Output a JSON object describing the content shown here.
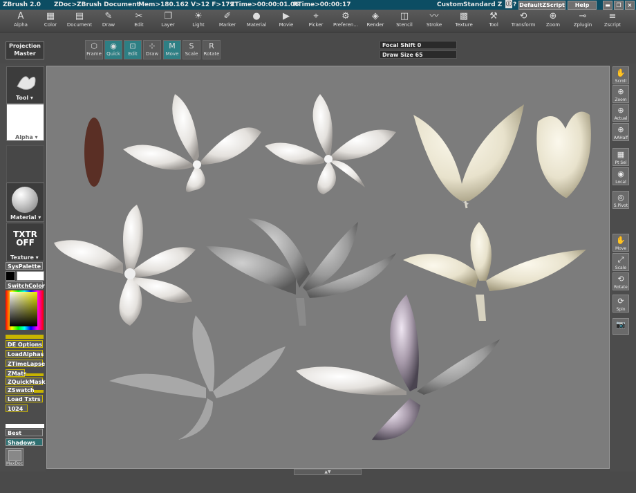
{
  "titlebar": {
    "app": "ZBrush 2.0",
    "doc": "ZDoc>ZBrush Document",
    "mem": "Mem>180.162 V>12 F>179",
    "ztime": "ZTime>00:00:01.06",
    "rtime": "RTime>00:00:17",
    "custom": "Custom",
    "standard": "Standard Z",
    "script": "DefaultZScript",
    "help": "Help"
  },
  "menu": [
    {
      "label": "Alpha",
      "icon": "A"
    },
    {
      "label": "Color",
      "icon": "▦"
    },
    {
      "label": "Document",
      "icon": "▤"
    },
    {
      "label": "Draw",
      "icon": "✎"
    },
    {
      "label": "Edit",
      "icon": "✂"
    },
    {
      "label": "Layer",
      "icon": "❐"
    },
    {
      "label": "Light",
      "icon": "☀"
    },
    {
      "label": "Marker",
      "icon": "✐"
    },
    {
      "label": "Material",
      "icon": "●"
    },
    {
      "label": "Movie",
      "icon": "▶"
    },
    {
      "label": "Picker",
      "icon": "⌖"
    },
    {
      "label": "Preferen...",
      "icon": "⚙"
    },
    {
      "label": "Render",
      "icon": "◈"
    },
    {
      "label": "Stencil",
      "icon": "◫"
    },
    {
      "label": "Stroke",
      "icon": "〰"
    },
    {
      "label": "Texture",
      "icon": "▩"
    },
    {
      "label": "Tool",
      "icon": "⚒"
    },
    {
      "label": "Transform",
      "icon": "⟲"
    },
    {
      "label": "Zoom",
      "icon": "⊕"
    },
    {
      "label": "Zplugin",
      "icon": "⊸"
    },
    {
      "label": "Zscript",
      "icon": "≡"
    }
  ],
  "toolbar": {
    "projection_master": "Projection Master",
    "buttons": [
      "Frame",
      "Quick",
      "Edit",
      "Draw",
      "Move",
      "Scale",
      "Rotate"
    ],
    "focal_shift": "Focal Shift 0",
    "draw_size": "Draw Size 65"
  },
  "left": {
    "tool": "Tool",
    "alpha": "Alpha",
    "material": "Material",
    "txtr": "TXTR",
    "off": "OFF",
    "texture": "Texture",
    "syspalette": "SysPalette",
    "switchcolor": "SwitchColor",
    "buttons": [
      "DE Options",
      "LoadAlphas",
      "ZTimeLapse",
      "ZMats",
      "ZQuickMask",
      "ZSwatch",
      "Load Txtrs",
      "1024"
    ],
    "best": "Best",
    "shadows": "Shadows",
    "maxdoc": "MaxDoc"
  },
  "right": [
    {
      "label": "Scroll",
      "icon": "✋"
    },
    {
      "label": "Zoom",
      "icon": "⊕"
    },
    {
      "label": "Actual",
      "icon": "⊕"
    },
    {
      "label": "AAHalf",
      "icon": "⊕"
    },
    {
      "label": "Pt Sel",
      "icon": "▦"
    },
    {
      "label": "Local",
      "icon": "◉"
    },
    {
      "label": "S.Pivot",
      "icon": "◎"
    },
    {
      "label": "Move",
      "icon": "✋"
    },
    {
      "label": "Scale",
      "icon": "⤢"
    },
    {
      "label": "Rotate",
      "icon": "⟲"
    },
    {
      "label": "Spin",
      "icon": "⟳"
    },
    {
      "label": "",
      "icon": "📷"
    }
  ]
}
